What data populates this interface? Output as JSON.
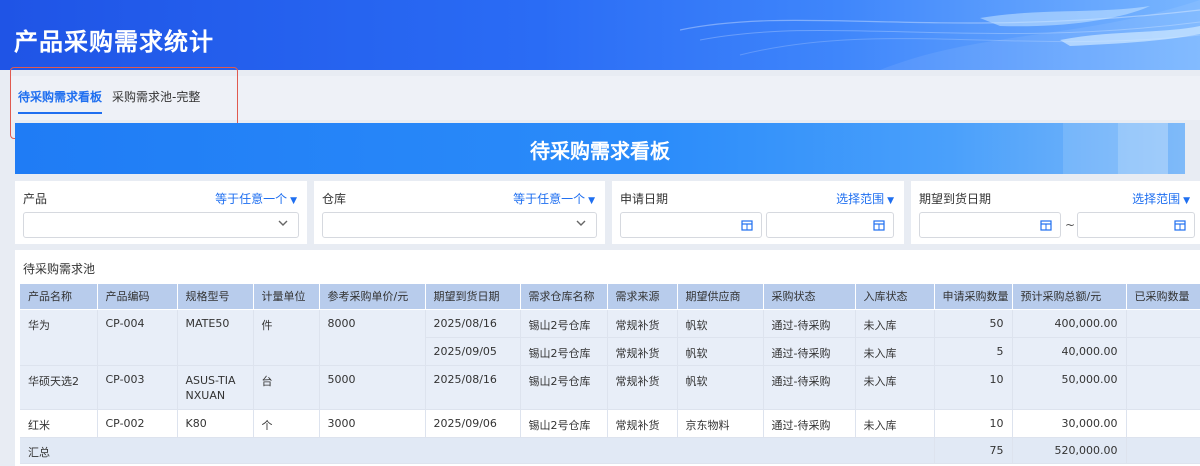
{
  "header": {
    "title": "产品采购需求统计"
  },
  "tabs": [
    {
      "label": "待采购需求看板",
      "active": true
    },
    {
      "label": "采购需求池-完整",
      "active": false
    }
  ],
  "banner": {
    "title": "待采购需求看板"
  },
  "filters": [
    {
      "label": "产品",
      "operator": "等于任意一个",
      "type": "select"
    },
    {
      "label": "仓库",
      "operator": "等于任意一个",
      "type": "select"
    },
    {
      "label": "申请日期",
      "operator": "选择范围",
      "type": "date-range",
      "separator": "~"
    },
    {
      "label": "期望到货日期",
      "operator": "选择范围",
      "type": "date-range",
      "separator": "~"
    }
  ],
  "panel": {
    "title": "待采购需求池"
  },
  "table": {
    "columns": [
      "产品名称",
      "产品编码",
      "规格型号",
      "计量单位",
      "参考采购单价/元",
      "期望到货日期",
      "需求仓库名称",
      "需求来源",
      "期望供应商",
      "采购状态",
      "入库状态",
      "申请采购数量",
      "预计采购总额/元",
      "已采购数量"
    ],
    "groups": [
      {
        "product": "华为",
        "code": "CP-004",
        "spec": "MATE50",
        "unit": "件",
        "price": "8000",
        "rows": [
          {
            "date": "2025/08/16",
            "warehouse": "锡山2号仓库",
            "source": "常规补货",
            "supplier": "帆软",
            "status": "通过-待采购",
            "stock": "未入库",
            "qty": "50",
            "total": "400,000.00",
            "purchased": ""
          },
          {
            "date": "2025/09/05",
            "warehouse": "锡山2号仓库",
            "source": "常规补货",
            "supplier": "帆软",
            "status": "通过-待采购",
            "stock": "未入库",
            "qty": "5",
            "total": "40,000.00",
            "purchased": ""
          }
        ]
      },
      {
        "product": "华硕天选2",
        "code": "CP-003",
        "spec": "ASUS-TIANXUAN",
        "unit": "台",
        "price": "5000",
        "rows": [
          {
            "date": "2025/08/16",
            "warehouse": "锡山2号仓库",
            "source": "常规补货",
            "supplier": "帆软",
            "status": "通过-待采购",
            "stock": "未入库",
            "qty": "10",
            "total": "50,000.00",
            "purchased": ""
          }
        ]
      },
      {
        "product": "红米",
        "code": "CP-002",
        "spec": "K80",
        "unit": "个",
        "price": "3000",
        "rows": [
          {
            "date": "2025/09/06",
            "warehouse": "锡山2号仓库",
            "source": "常规补货",
            "supplier": "京东物料",
            "status": "通过-待采购",
            "stock": "未入库",
            "qty": "10",
            "total": "30,000.00",
            "purchased": ""
          }
        ]
      }
    ],
    "summary": {
      "label": "汇总",
      "qty": "75",
      "total": "520,000.00"
    }
  },
  "colors": {
    "accent": "#1f6ff0",
    "header_bg": "#2a6cf5",
    "table_header": "#b8ccec",
    "row_shade": "#e8eef8",
    "highlight_outline": "#e05a4f"
  }
}
